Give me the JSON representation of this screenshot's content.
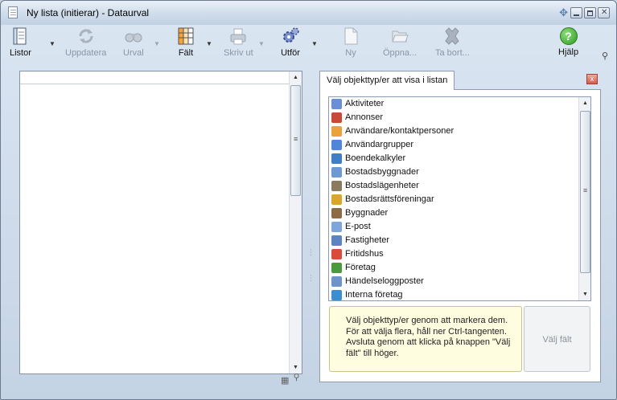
{
  "window": {
    "title": "Ny lista (initierar) - Dataurval"
  },
  "toolbar": {
    "items": [
      {
        "label": "Listor",
        "icon": "list-icon",
        "enabled": true
      },
      {
        "label": "Uppdatera",
        "icon": "refresh-icon",
        "enabled": false
      },
      {
        "label": "Urval",
        "icon": "binoculars-icon",
        "enabled": false
      },
      {
        "label": "Fält",
        "icon": "columns-icon",
        "enabled": true
      },
      {
        "label": "Skriv ut",
        "icon": "printer-icon",
        "enabled": false
      },
      {
        "label": "Utför",
        "icon": "gears-icon",
        "enabled": true
      },
      {
        "label": "Ny",
        "icon": "new-document-icon",
        "enabled": false
      },
      {
        "label": "Öppna...",
        "icon": "folder-open-icon",
        "enabled": false
      },
      {
        "label": "Ta bort...",
        "icon": "delete-icon",
        "enabled": false
      },
      {
        "label": "Hjälp",
        "icon": "help-icon",
        "enabled": true
      }
    ]
  },
  "right_panel": {
    "tab_label": "Välj objekttyp/er att visa i listan",
    "object_types": [
      "Aktiviteter",
      "Annonser",
      "Användare/kontaktpersoner",
      "Användargrupper",
      "Boendekalkyler",
      "Bostadsbyggnader",
      "Bostadslägenheter",
      "Bostadsrättsföreningar",
      "Byggnader",
      "E-post",
      "Fastigheter",
      "Fritidshus",
      "Företag",
      "Händelseloggposter",
      "Interna företag"
    ],
    "info_text": "Välj objekttyp/er genom att markera dem. För att välja flera, håll ner Ctrl-tangenten. Avsluta genom att klicka på knappen \"Välj fält\" till höger.",
    "select_fields_button": "Välj fält"
  },
  "colors": {
    "accent": "#5b7fb0",
    "info_bg": "#fffde0",
    "help_green": "#2f9a21",
    "close_red": "#d85a4a"
  }
}
